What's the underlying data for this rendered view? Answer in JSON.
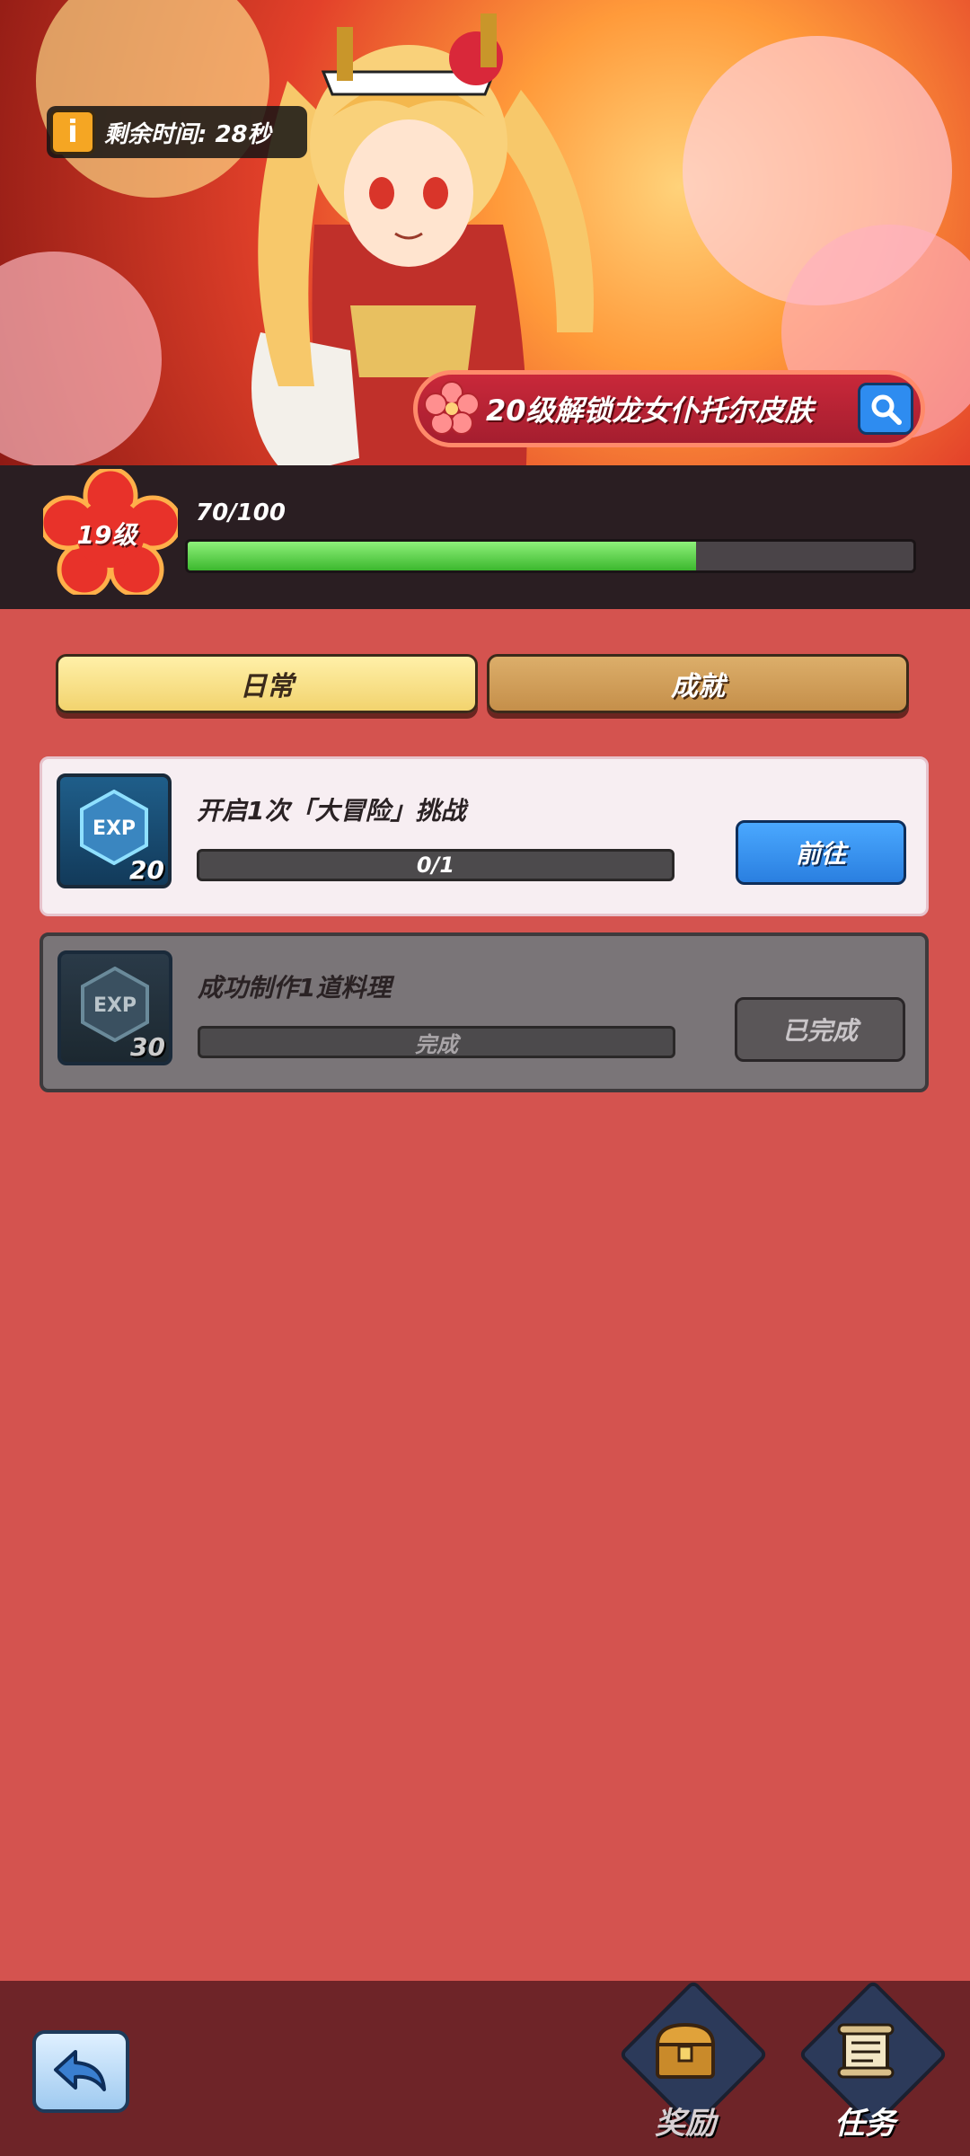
{
  "banner": {
    "timer_text": "剩余时间: 28秒",
    "skin_unlock_text": "20级解锁龙女仆托尔皮肤"
  },
  "level": {
    "level_text": "19级",
    "exp_text": "70/100",
    "progress_fraction": 0.7
  },
  "tabs": [
    {
      "label": "日常",
      "active": true
    },
    {
      "label": "成就",
      "active": false
    }
  ],
  "tasks": [
    {
      "title": "开启1次「大冒险」挑战",
      "exp_icon_text": "EXP",
      "exp_reward": "20",
      "progress_text": "0/1",
      "button_label": "前往",
      "completed": false
    },
    {
      "title": "成功制作1道料理",
      "exp_icon_text": "EXP",
      "exp_reward": "30",
      "progress_text": "完成",
      "button_label": "已完成",
      "completed": true
    }
  ],
  "bottom_nav": [
    {
      "label": "奖励",
      "icon": "treasure-chest-icon"
    },
    {
      "label": "任务",
      "icon": "scroll-icon"
    }
  ],
  "icons": {
    "info": "info-icon",
    "search": "search-icon",
    "back": "back-arrow-icon"
  },
  "colors": {
    "background": "#d4534f",
    "exp_fill": "#3cb82e",
    "go_button": "#2a7fe0"
  }
}
